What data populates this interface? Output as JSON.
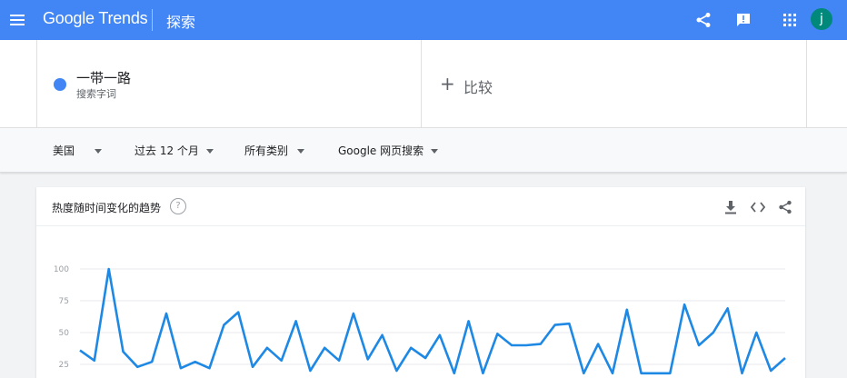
{
  "header": {
    "logo_text": "Google Trends",
    "title": "探索",
    "avatar_letter": "j",
    "icons": [
      "menu-icon",
      "share-icon",
      "feedback-icon",
      "apps-icon"
    ]
  },
  "term": {
    "name": "一带一路",
    "subtitle": "搜索字词",
    "color": "#4285f4"
  },
  "compare": {
    "plus": "+",
    "label": "比较"
  },
  "filters": [
    {
      "label": "美国"
    },
    {
      "label": "过去 12 个月"
    },
    {
      "label": "所有类别"
    },
    {
      "label": "Google 网页搜索"
    }
  ],
  "card": {
    "title": "热度随时间变化的趋势",
    "help_symbol": "?",
    "icons": [
      "download-icon",
      "embed-icon",
      "share-icon"
    ]
  },
  "chart_data": {
    "type": "line",
    "series": [
      {
        "values": [
          36,
          28,
          100,
          35,
          23,
          27,
          65,
          22,
          27,
          22,
          56,
          66,
          23,
          38,
          28,
          59,
          20,
          38,
          28,
          65,
          29,
          48,
          20,
          38,
          30,
          48,
          18,
          59,
          18,
          49,
          40,
          40,
          41,
          56,
          57,
          18,
          41,
          18,
          68,
          18,
          18,
          18,
          72,
          40,
          50,
          69,
          18,
          50,
          20,
          30
        ],
        "color": "#1e88e5"
      }
    ],
    "yticks": [
      "100",
      "75",
      "50",
      "25"
    ],
    "ylim": [
      0,
      100
    ],
    "grid": true
  }
}
